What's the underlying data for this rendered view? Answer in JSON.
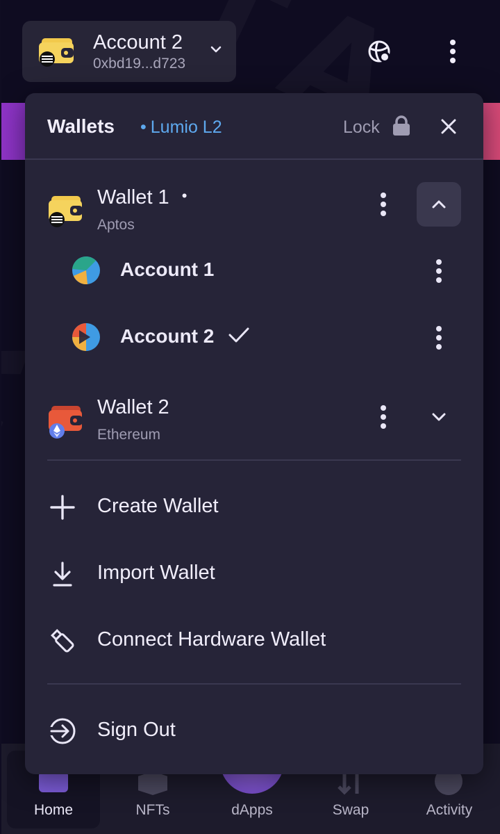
{
  "header": {
    "account_name": "Account 2",
    "account_address": "0xbd19...d723"
  },
  "panel": {
    "title": "Wallets",
    "network": "Lumio L2",
    "lock_label": "Lock"
  },
  "wallets": [
    {
      "name": "Wallet 1",
      "chain": "Aptos",
      "active_marker": "•",
      "expanded": true,
      "accounts": [
        {
          "name": "Account 1",
          "selected": false
        },
        {
          "name": "Account 2",
          "selected": true
        }
      ]
    },
    {
      "name": "Wallet 2",
      "chain": "Ethereum",
      "expanded": false
    }
  ],
  "actions": {
    "create": "Create Wallet",
    "import": "Import Wallet",
    "hardware": "Connect Hardware Wallet",
    "signout": "Sign Out"
  },
  "bottom_nav": [
    {
      "label": "Home",
      "icon": "home-icon",
      "active": true
    },
    {
      "label": "NFTs",
      "icon": "nfts-icon"
    },
    {
      "label": "dApps",
      "icon": "dapps-icon"
    },
    {
      "label": "Swap",
      "icon": "swap-icon"
    },
    {
      "label": "Activity",
      "icon": "activity-icon"
    }
  ],
  "colors": {
    "accent_blue": "#5ea9ef",
    "wallet_aptos": "#f2c94c",
    "wallet_ethereum": "#e8593a",
    "panel_bg": "#262438"
  }
}
